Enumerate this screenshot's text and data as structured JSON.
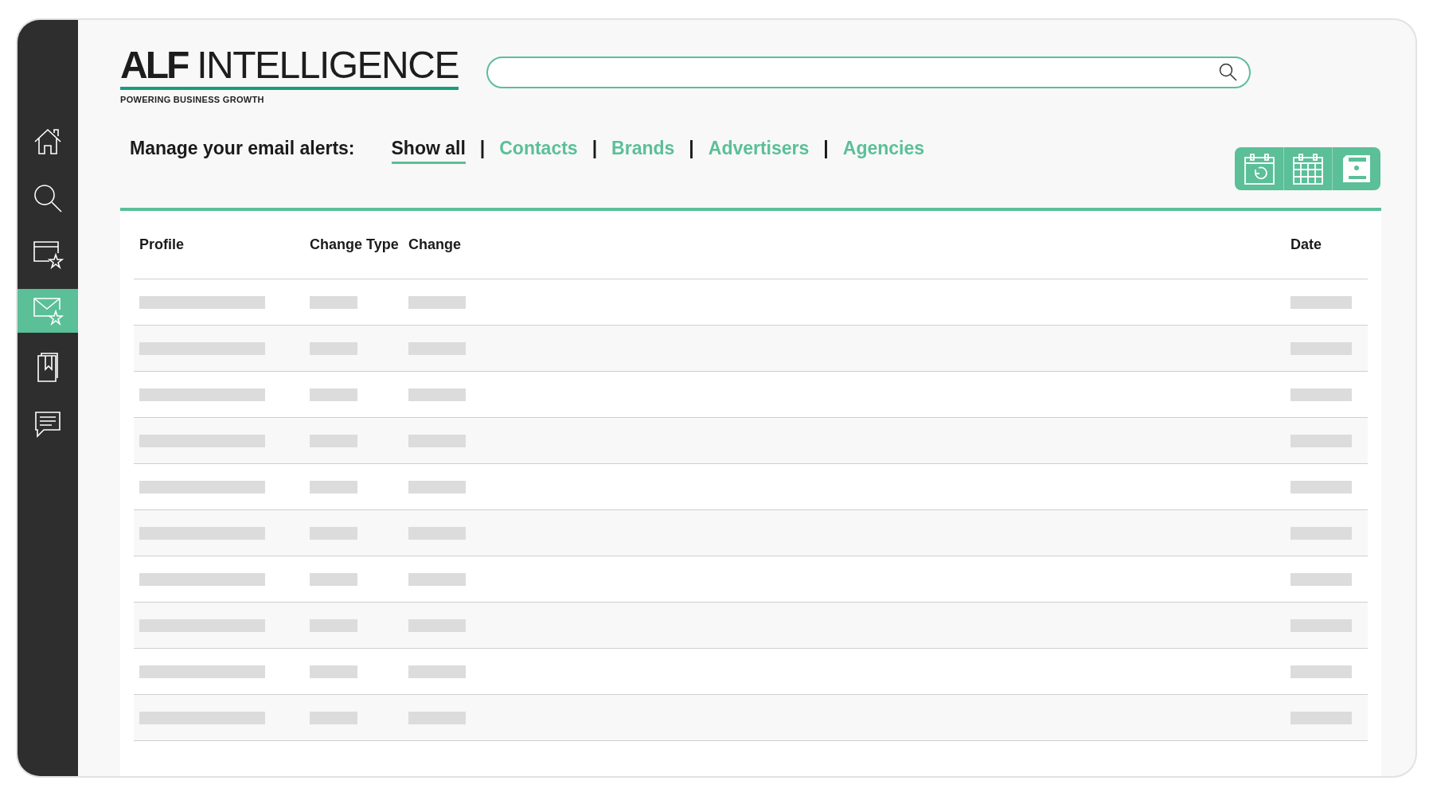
{
  "sidebar": {
    "items": [
      {
        "selected": false
      },
      {
        "selected": false
      },
      {
        "selected": false
      },
      {
        "selected": true
      },
      {
        "selected": false
      },
      {
        "selected": false
      }
    ]
  },
  "logo": {
    "title": "**ALF** INTELLIGENCE",
    "tagline": "POWERING BUSINESS GROWTH"
  },
  "nav": {
    "label": "Manage your email alerts:",
    "tabs": [
      {
        "label": "Show all",
        "selected": true
      },
      {
        "label": "Contacts",
        "selected": false
      },
      {
        "label": "Brands",
        "selected": false
      },
      {
        "label": "Advertisers",
        "selected": false
      },
      {
        "label": "Agencies",
        "selected": false
      }
    ],
    "separator": "|"
  },
  "table": {
    "columns": [
      "Profile",
      "Change Type",
      "Change",
      "Date"
    ],
    "rows": [
      {
        "kind": "skeleton"
      },
      {
        "kind": "skeleton"
      },
      {
        "kind": "skeleton"
      },
      {
        "kind": "skeleton"
      },
      {
        "kind": "skeleton"
      },
      {
        "kind": "skeleton"
      },
      {
        "kind": "skeleton"
      },
      {
        "kind": "skeleton"
      },
      {
        "kind": "skeleton"
      },
      {
        "kind": "skeleton"
      }
    ]
  }
}
